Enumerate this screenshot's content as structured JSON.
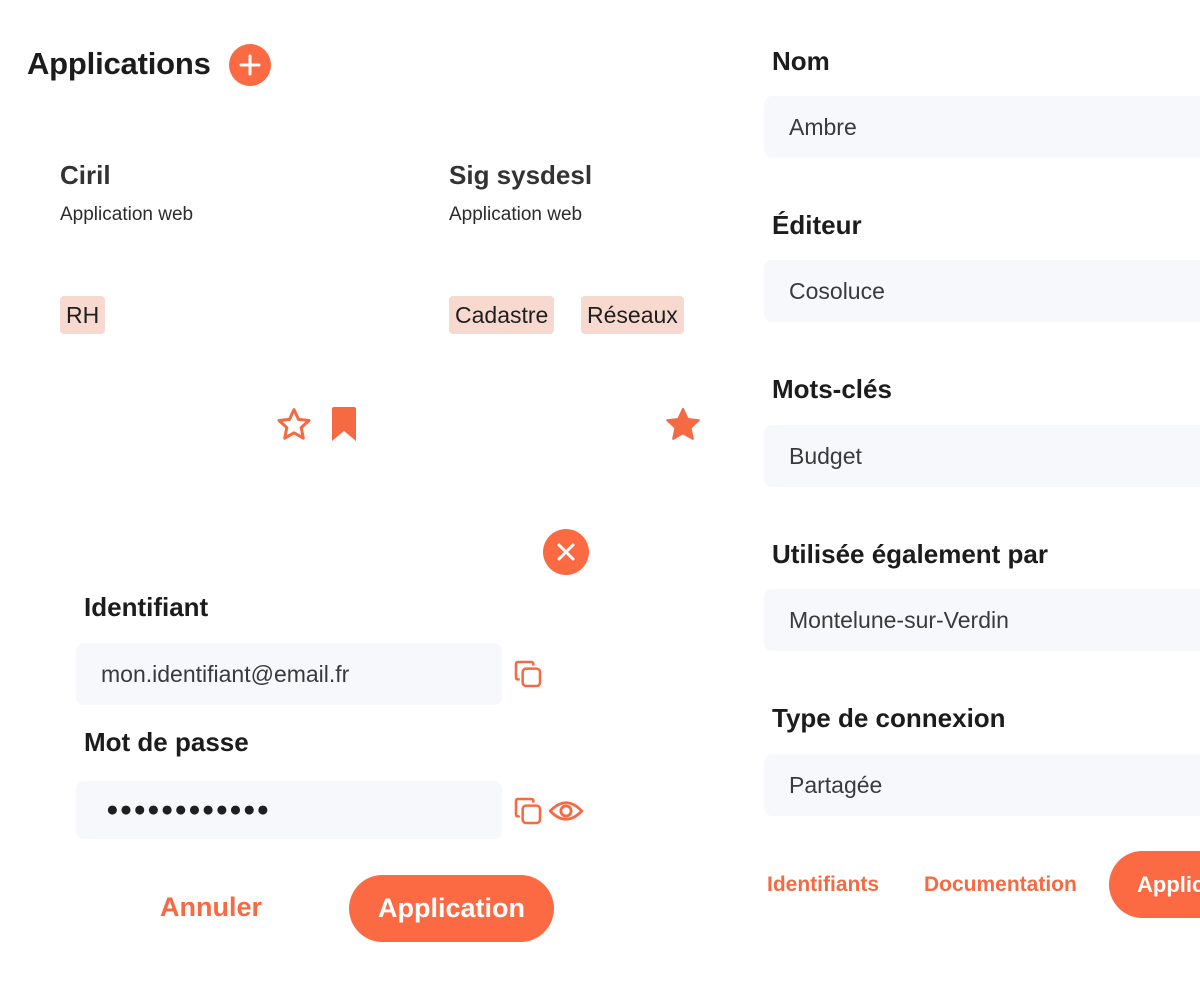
{
  "header": {
    "title": "Applications"
  },
  "cards": [
    {
      "name": "Ciril",
      "type": "Application web",
      "tags": [
        "RH"
      ],
      "favorite": false,
      "bookmarked": true
    },
    {
      "name": "Sig sysdesl",
      "type": "Application web",
      "tags": [
        "Cadastre",
        "Réseaux"
      ],
      "favorite": true,
      "bookmarked": false
    }
  ],
  "credentials": {
    "identifiant_label": "Identifiant",
    "identifiant_value": "mon.identifiant@email.fr",
    "password_label": "Mot de passe",
    "password_value": "●●●●●●●●●●●●",
    "cancel_label": "Annuler",
    "submit_label": "Application"
  },
  "details": {
    "nom_label": "Nom",
    "nom_value": "Ambre",
    "editeur_label": "Éditeur",
    "editeur_value": "Cosoluce",
    "mots_label": "Mots-clés",
    "mots_value": "Budget",
    "utilisee_label": "Utilisée également par",
    "utilisee_value": "Montelune-sur-Verdin",
    "type_label": "Type de connexion",
    "type_value": "Partagée",
    "identifiants_label": "Identifiants",
    "documentation_label": "Documentation",
    "application_label": "Application"
  },
  "colors": {
    "accent": "#fb6a43",
    "tag_bg": "#f8d9d0",
    "field_bg": "#f7f8fb"
  }
}
